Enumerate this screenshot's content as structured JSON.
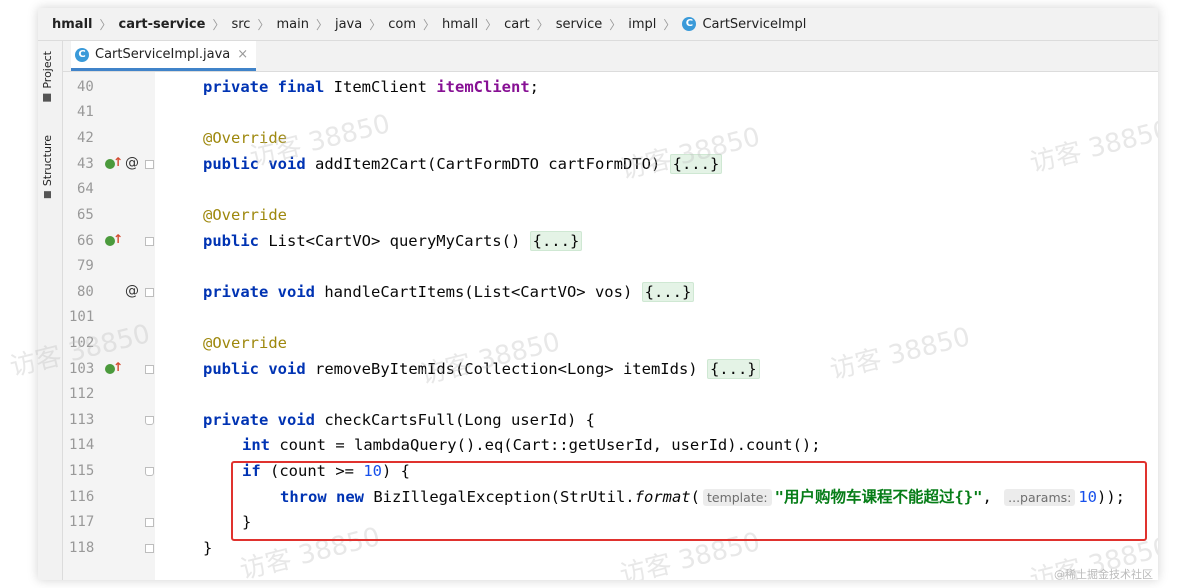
{
  "breadcrumb": {
    "items": [
      "hmall",
      "cart-service",
      "src",
      "main",
      "java",
      "com",
      "hmall",
      "cart",
      "service",
      "impl"
    ],
    "class_icon_letter": "C",
    "class_name": "CartServiceImpl"
  },
  "tool_windows": {
    "project": "Project",
    "structure": "Structure"
  },
  "tab": {
    "icon_letter": "C",
    "label": "CartServiceImpl.java",
    "close": "×"
  },
  "line_numbers": [
    "40",
    "41",
    "42",
    "43",
    "64",
    "65",
    "66",
    "79",
    "80",
    "101",
    "102",
    "103",
    "112",
    "113",
    "114",
    "115",
    "116",
    "117",
    "118"
  ],
  "code": {
    "l40": [
      "private",
      " ",
      "final",
      " ItemClient ",
      "itemClient",
      ";"
    ],
    "l42": "@Override",
    "l43": [
      "public",
      " ",
      "void",
      " addItem2Cart(CartFormDTO cartFormDTO) ",
      "{...}"
    ],
    "l65": "@Override",
    "l66": [
      "public",
      " List<CartVO> queryMyCarts() ",
      "{...}"
    ],
    "l80": [
      "private",
      " ",
      "void",
      " handleCartItems(List<CartVO> vos) ",
      "{...}"
    ],
    "l102": "@Override",
    "l103": [
      "public",
      " ",
      "void",
      " removeByItemIds(Collection<Long> itemIds) ",
      "{...}"
    ],
    "l113": [
      "private",
      " ",
      "void",
      " checkCartsFull(Long userId) {"
    ],
    "l114": [
      "int",
      " count = lambdaQuery().eq(Cart::getUserId, userId).count();"
    ],
    "l115": [
      "if",
      " (count >= ",
      "10",
      ") {"
    ],
    "l116": [
      "throw",
      " ",
      "new",
      " BizIllegalException(StrUtil.",
      "format",
      "(",
      "template:",
      "\"用户购物车课程不能超过{}\"",
      ", ",
      "...params:",
      "10",
      "));"
    ],
    "l117": "}",
    "l118": "}"
  },
  "gutter_marks": {
    "at_symbol": "@",
    "up_arrow": "↑"
  },
  "watermark": "访客 38850",
  "credit": "@稀土掘金技术社区"
}
